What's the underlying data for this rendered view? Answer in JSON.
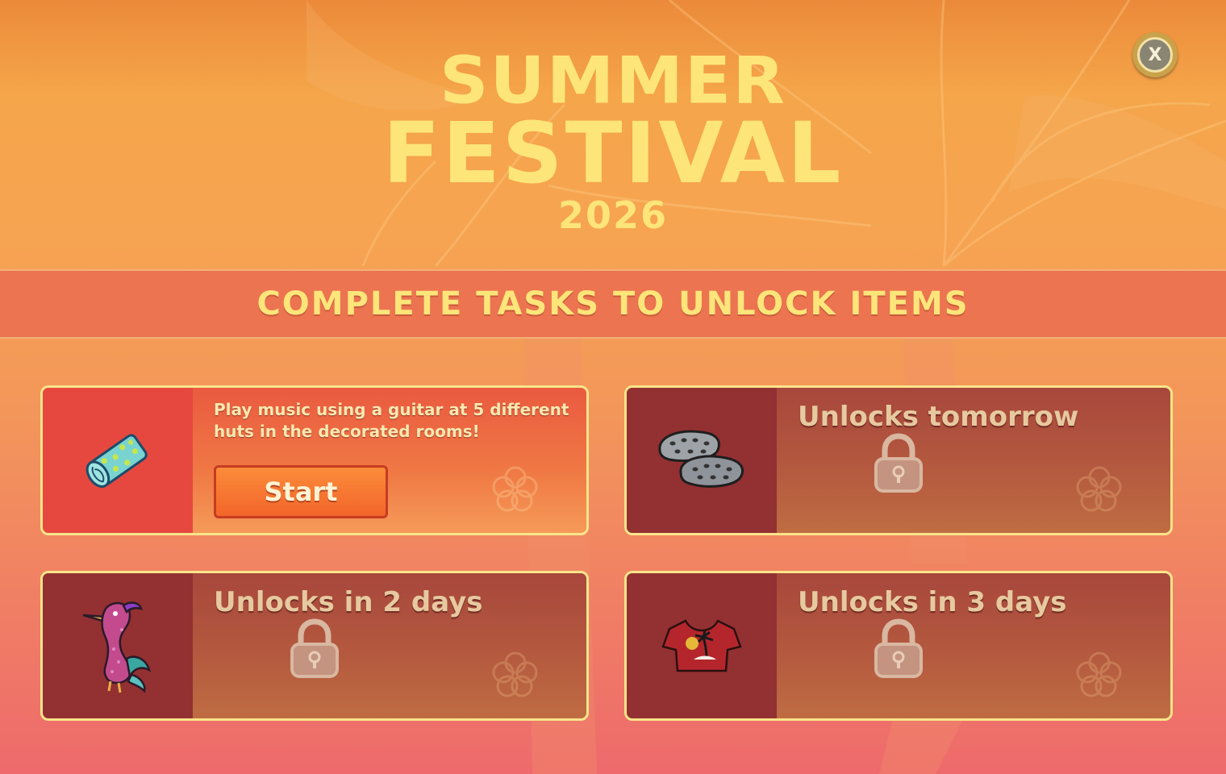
{
  "title": {
    "line1": "SUMMER",
    "line2": "FESTIVAL",
    "year": "2026"
  },
  "banner": "COMPLETE TASKS TO UNLOCK ITEMS",
  "close_label": "X",
  "tasks": [
    {
      "item": "towel-roll",
      "description": "Play music using a guitar at 5 different huts in the decorated rooms!",
      "button": "Start",
      "locked": false
    },
    {
      "item": "gray-clogs",
      "status": "Unlocks tomorrow",
      "locked": true
    },
    {
      "item": "bird-plush",
      "status": "Unlocks in 2 days",
      "locked": true
    },
    {
      "item": "palm-tree-shirt",
      "status": "Unlocks in 3 days",
      "locked": true
    }
  ],
  "colors": {
    "title": "#fde57a",
    "banner": "#ec7450",
    "card_border": "#f8e58a",
    "start_button": "#f3652a"
  }
}
